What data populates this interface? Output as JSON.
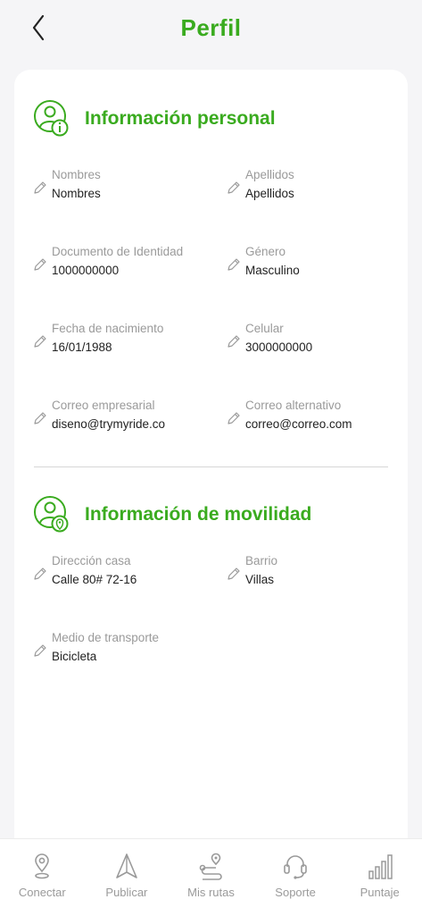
{
  "header": {
    "title": "Perfil"
  },
  "personal": {
    "title": "Información personal",
    "fields": [
      {
        "label": "Nombres",
        "value": "Nombres"
      },
      {
        "label": "Apellidos",
        "value": "Apellidos"
      },
      {
        "label": "Documento de Identidad",
        "value": "1000000000"
      },
      {
        "label": "Género",
        "value": "Masculino"
      },
      {
        "label": "Fecha de nacimiento",
        "value": "16/01/1988"
      },
      {
        "label": "Celular",
        "value": "3000000000"
      },
      {
        "label": "Correo empresarial",
        "value": "diseno@trymyride.co"
      },
      {
        "label": "Correo alternativo",
        "value": "correo@correo.com"
      }
    ]
  },
  "mobility": {
    "title": "Información de movilidad",
    "fields": [
      {
        "label": "Dirección casa",
        "value": "Calle 80# 72-16"
      },
      {
        "label": "Barrio",
        "value": "Villas"
      },
      {
        "label": "Medio de transporte",
        "value": "Bicicleta"
      }
    ]
  },
  "nav": {
    "items": [
      {
        "label": "Conectar",
        "icon": "location-pin-icon"
      },
      {
        "label": "Publicar",
        "icon": "navigation-arrow-icon"
      },
      {
        "label": "Mis rutas",
        "icon": "route-icon"
      },
      {
        "label": "Soporte",
        "icon": "headset-icon"
      },
      {
        "label": "Puntaje",
        "icon": "bar-chart-icon"
      }
    ]
  },
  "colors": {
    "accent": "#3aab1f",
    "label": "#9a9a9a",
    "value": "#222222",
    "background": "#f5f5f7"
  }
}
